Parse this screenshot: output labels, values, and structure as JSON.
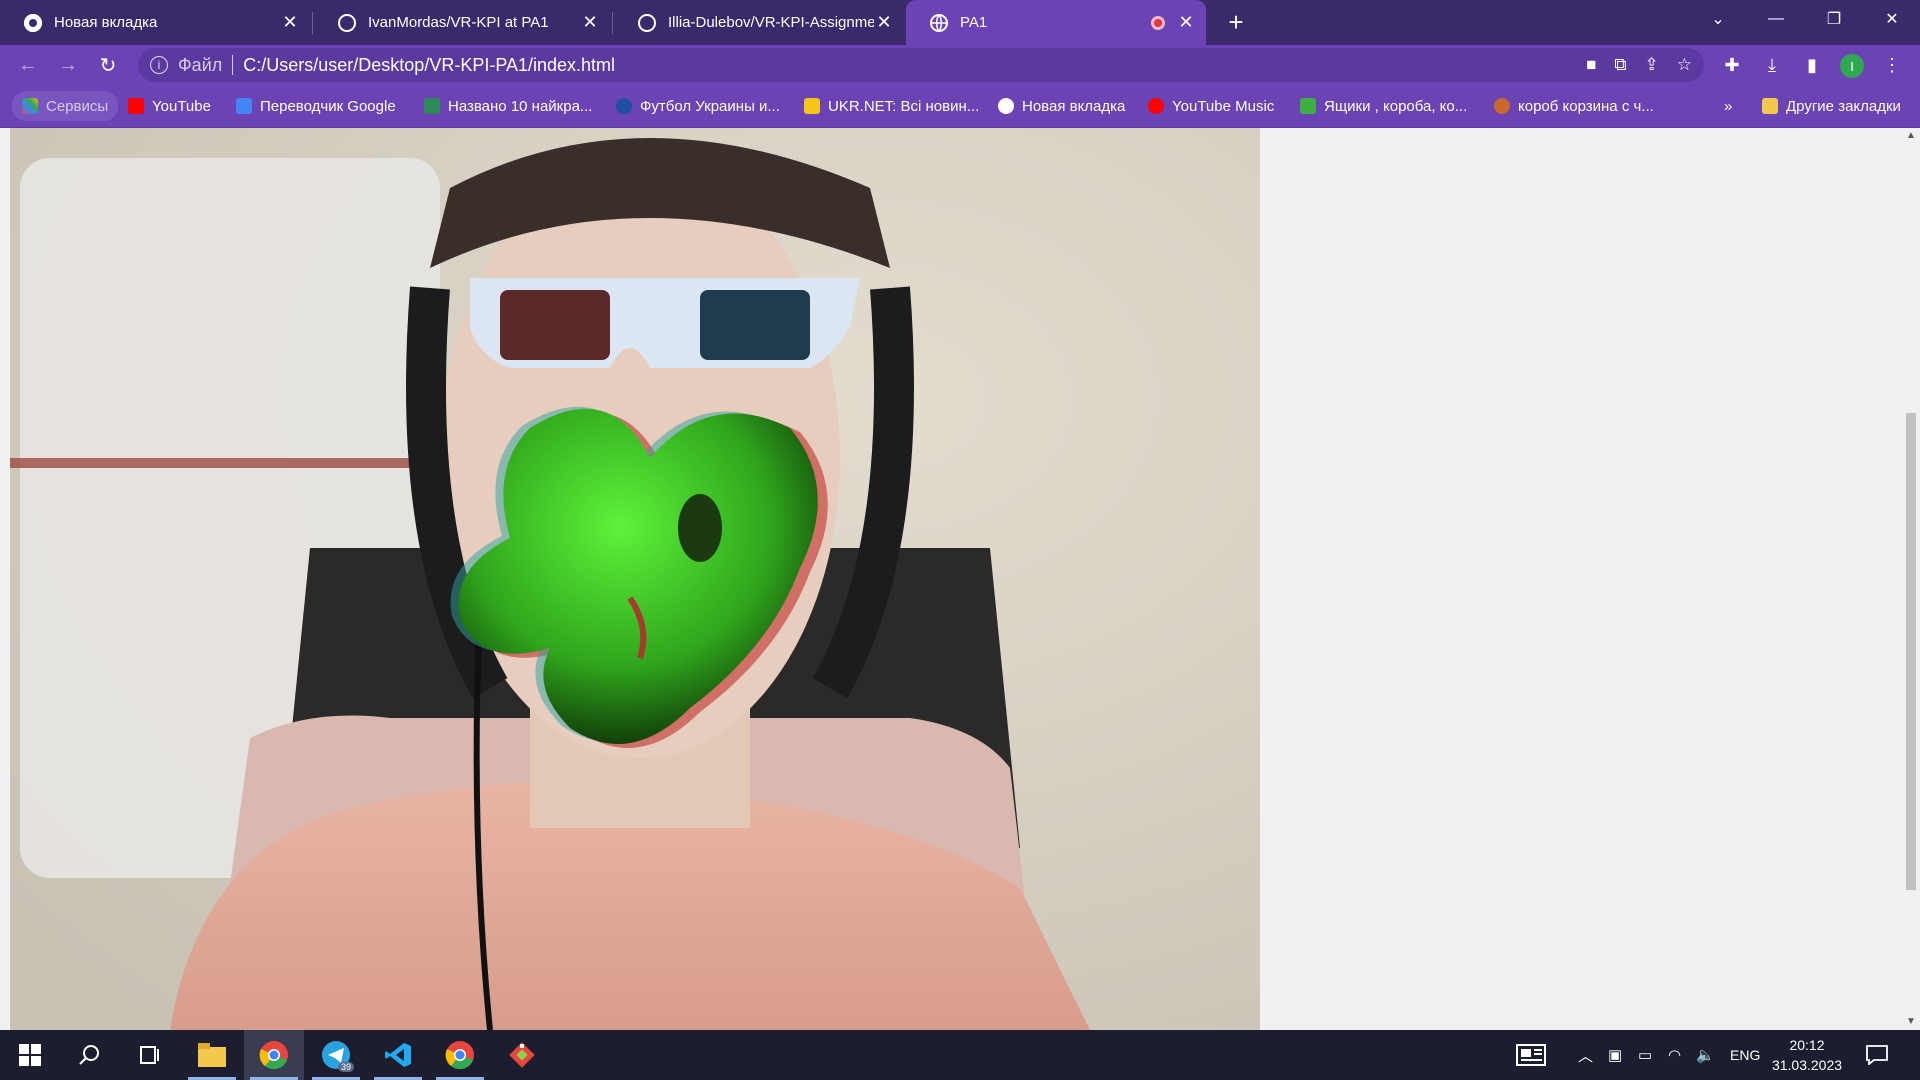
{
  "browser": {
    "tabs": [
      {
        "label": "Новая вкладка",
        "icon": "chrome-icon"
      },
      {
        "label": "IvanMordas/VR-KPI at PA1",
        "icon": "github-icon"
      },
      {
        "label": "Illia-Dulebov/VR-KPI-Assignment",
        "icon": "github-icon"
      },
      {
        "label": "PA1",
        "icon": "globe-icon",
        "active": true,
        "recording": true
      }
    ],
    "address": {
      "file_label": "Файл",
      "url": "C:/Users/user/Desktop/VR-KPI-PA1/index.html"
    },
    "profile_initial": "I",
    "bookmarks": [
      {
        "label": "Сервисы",
        "color": "#e8453c"
      },
      {
        "label": "YouTube",
        "color": "#ff0000"
      },
      {
        "label": "Переводчик Google",
        "color": "#4285f4"
      },
      {
        "label": "Названо 10 найкра...",
        "color": "#2e8b57"
      },
      {
        "label": "Футбол Украины и...",
        "color": "#1f4fa3"
      },
      {
        "label": "UKR.NET: Всі новин...",
        "color": "#f5c518"
      },
      {
        "label": "Новая вкладка",
        "color": "#ffffff"
      },
      {
        "label": "YouTube Music",
        "color": "#ff0000"
      },
      {
        "label": "Ящики , короба, ко...",
        "color": "#3cb043"
      },
      {
        "label": "короб корзина с ч...",
        "color": "#c96a2a"
      }
    ],
    "bookmarks_overflow": "»",
    "other_bookmarks": "Другие закладки"
  },
  "taskbar": {
    "apps": [
      "start-icon",
      "search-icon",
      "task-view-icon",
      "file-explorer-icon",
      "chrome-icon",
      "telegram-icon",
      "vscode-icon",
      "chrome-profile-icon",
      "git-icon"
    ],
    "telegram_badge": "39",
    "language": "ENG",
    "time": "20:12",
    "date": "31.03.2023"
  }
}
